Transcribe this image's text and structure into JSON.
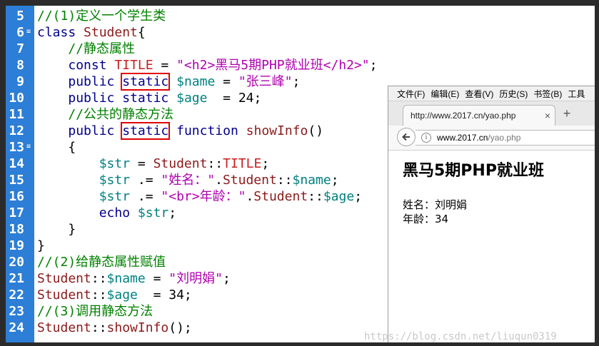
{
  "editor": {
    "line_numbers": [
      "5",
      "6",
      "7",
      "8",
      "9",
      "10",
      "11",
      "12",
      "13",
      "14",
      "15",
      "16",
      "17",
      "18",
      "19",
      "20",
      "21",
      "22",
      "23",
      "24"
    ],
    "lines": [
      [
        {
          "cls": "c",
          "text": "//(1)定义一个学生类"
        }
      ],
      [
        {
          "cls": "k",
          "text": "class"
        },
        {
          "cls": "p",
          "text": " "
        },
        {
          "cls": "m",
          "text": "Student"
        },
        {
          "cls": "p",
          "text": "{"
        }
      ],
      [
        {
          "cls": "p",
          "text": "    "
        },
        {
          "cls": "c",
          "text": "//静态属性"
        }
      ],
      [
        {
          "cls": "p",
          "text": "    "
        },
        {
          "cls": "k",
          "text": "const"
        },
        {
          "cls": "p",
          "text": " "
        },
        {
          "cls": "t",
          "text": "TITLE"
        },
        {
          "cls": "p",
          "text": " = "
        },
        {
          "cls": "s",
          "text": "\"<h2>黑马5期PHP就业班</h2>\""
        },
        {
          "cls": "p",
          "text": ";"
        }
      ],
      [
        {
          "cls": "p",
          "text": "    "
        },
        {
          "cls": "k",
          "text": "public"
        },
        {
          "cls": "p",
          "text": " "
        },
        {
          "cls": "k box",
          "text": "static"
        },
        {
          "cls": "p",
          "text": " "
        },
        {
          "cls": "v",
          "text": "$name"
        },
        {
          "cls": "p",
          "text": " = "
        },
        {
          "cls": "s",
          "text": "\"张三峰\""
        },
        {
          "cls": "p",
          "text": ";"
        }
      ],
      [
        {
          "cls": "p",
          "text": "    "
        },
        {
          "cls": "k",
          "text": "public"
        },
        {
          "cls": "p",
          "text": " "
        },
        {
          "cls": "k",
          "text": "static"
        },
        {
          "cls": "p",
          "text": " "
        },
        {
          "cls": "v",
          "text": "$age"
        },
        {
          "cls": "p",
          "text": "  = 24;"
        }
      ],
      [
        {
          "cls": "p",
          "text": "    "
        },
        {
          "cls": "c",
          "text": "//公共的静态方法"
        }
      ],
      [
        {
          "cls": "p",
          "text": "    "
        },
        {
          "cls": "k",
          "text": "public"
        },
        {
          "cls": "p",
          "text": " "
        },
        {
          "cls": "k box",
          "text": "static"
        },
        {
          "cls": "p",
          "text": " "
        },
        {
          "cls": "k",
          "text": "function"
        },
        {
          "cls": "p",
          "text": " "
        },
        {
          "cls": "m",
          "text": "showInfo"
        },
        {
          "cls": "p",
          "text": "()"
        }
      ],
      [
        {
          "cls": "p",
          "text": "    {"
        }
      ],
      [
        {
          "cls": "p",
          "text": "        "
        },
        {
          "cls": "v",
          "text": "$str"
        },
        {
          "cls": "p",
          "text": " = "
        },
        {
          "cls": "m",
          "text": "Student"
        },
        {
          "cls": "p",
          "text": "::"
        },
        {
          "cls": "t",
          "text": "TITLE"
        },
        {
          "cls": "p",
          "text": ";"
        }
      ],
      [
        {
          "cls": "p",
          "text": "        "
        },
        {
          "cls": "v",
          "text": "$str"
        },
        {
          "cls": "p",
          "text": " .= "
        },
        {
          "cls": "s",
          "text": "\"姓名：\""
        },
        {
          "cls": "p",
          "text": "."
        },
        {
          "cls": "m",
          "text": "Student"
        },
        {
          "cls": "p",
          "text": "::"
        },
        {
          "cls": "v",
          "text": "$name"
        },
        {
          "cls": "p",
          "text": ";"
        }
      ],
      [
        {
          "cls": "p",
          "text": "        "
        },
        {
          "cls": "v",
          "text": "$str"
        },
        {
          "cls": "p",
          "text": " .= "
        },
        {
          "cls": "s",
          "text": "\"<br>年龄：\""
        },
        {
          "cls": "p",
          "text": "."
        },
        {
          "cls": "m",
          "text": "Student"
        },
        {
          "cls": "p",
          "text": "::"
        },
        {
          "cls": "v",
          "text": "$age"
        },
        {
          "cls": "p",
          "text": ";"
        }
      ],
      [
        {
          "cls": "p",
          "text": "        "
        },
        {
          "cls": "k",
          "text": "echo"
        },
        {
          "cls": "p",
          "text": " "
        },
        {
          "cls": "v",
          "text": "$str"
        },
        {
          "cls": "p",
          "text": ";"
        }
      ],
      [
        {
          "cls": "p",
          "text": "    }"
        }
      ],
      [
        {
          "cls": "p",
          "text": "}"
        }
      ],
      [
        {
          "cls": "c",
          "text": "//(2)给静态属性赋值"
        }
      ],
      [
        {
          "cls": "m",
          "text": "Student"
        },
        {
          "cls": "p",
          "text": "::"
        },
        {
          "cls": "v",
          "text": "$name"
        },
        {
          "cls": "p",
          "text": " = "
        },
        {
          "cls": "s",
          "text": "\"刘明娟\""
        },
        {
          "cls": "p",
          "text": ";"
        }
      ],
      [
        {
          "cls": "m",
          "text": "Student"
        },
        {
          "cls": "p",
          "text": "::"
        },
        {
          "cls": "v",
          "text": "$age"
        },
        {
          "cls": "p",
          "text": "  = 34;"
        }
      ],
      [
        {
          "cls": "c",
          "text": "//(3)调用静态方法"
        }
      ],
      [
        {
          "cls": "m",
          "text": "Student"
        },
        {
          "cls": "p",
          "text": "::"
        },
        {
          "cls": "m",
          "text": "showInfo"
        },
        {
          "cls": "p",
          "text": "();"
        }
      ]
    ],
    "fold_markers": [
      "6",
      "13"
    ],
    "colors": {
      "gutter": "#2c7ed6",
      "keyword": "#00008b",
      "comment": "#008000",
      "string": "#b000b0",
      "variable": "#008080",
      "highlight_box": "#e00000"
    }
  },
  "browser": {
    "menu": [
      "文件(F)",
      "编辑(E)",
      "查看(V)",
      "历史(S)",
      "书签(B)",
      "工具"
    ],
    "tab": {
      "label": "http://www.2017.cn/yao.php",
      "close": "×"
    },
    "new_tab": "+",
    "url": {
      "host": "www.2017.cn",
      "path": "/yao.php"
    },
    "page": {
      "heading": "黑马5期PHP就业班",
      "name_line": "姓名：刘明娟",
      "age_line": "年龄：34"
    }
  },
  "watermark": "https://blog.csdn.net/liuqun0319"
}
